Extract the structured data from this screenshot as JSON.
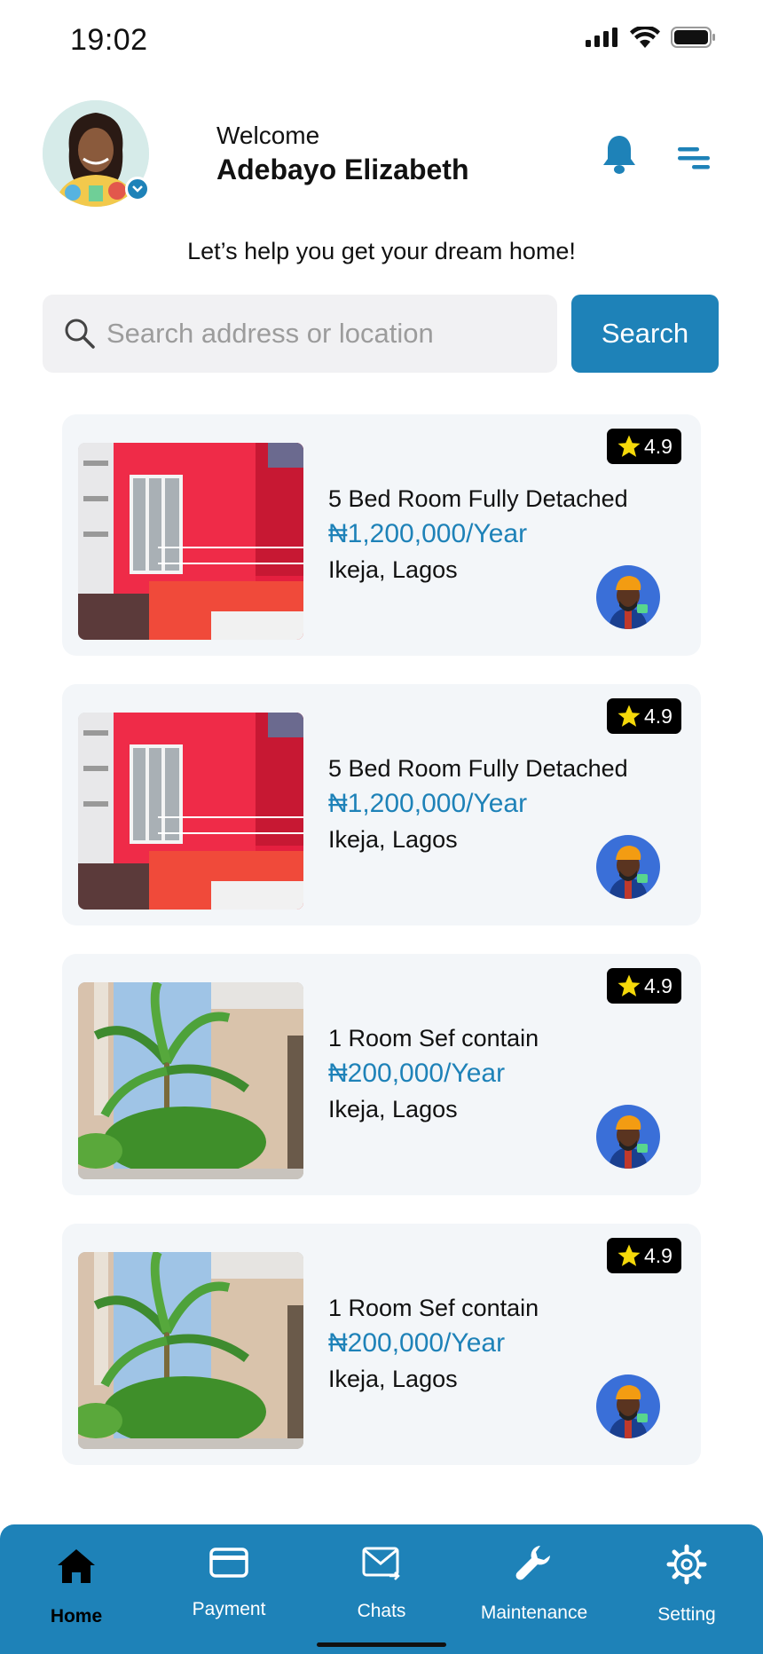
{
  "status_bar": {
    "time": "19:02"
  },
  "header": {
    "welcome": "Welcome",
    "user_name": "Adebayo Elizabeth",
    "tagline": "Let’s help you get your dream home!"
  },
  "search": {
    "placeholder": "Search address or location",
    "button_label": "Search"
  },
  "listings": [
    {
      "title": "5 Bed Room Fully Detached",
      "price": "₦1,200,000/Year",
      "location": "Ikeja, Lagos",
      "rating": "4.9",
      "image": "red-house"
    },
    {
      "title": "5 Bed Room Fully Detached",
      "price": "₦1,200,000/Year",
      "location": "Ikeja, Lagos",
      "rating": "4.9",
      "image": "red-house"
    },
    {
      "title": "1 Room Sef contain",
      "price": "₦200,000/Year",
      "location": "Ikeja, Lagos",
      "rating": "4.9",
      "image": "palm-building"
    },
    {
      "title": "1 Room Sef contain",
      "price": "₦200,000/Year",
      "location": "Ikeja, Lagos",
      "rating": "4.9",
      "image": "palm-building"
    }
  ],
  "bottom_nav": {
    "items": [
      {
        "label": "Home",
        "icon": "home-icon",
        "active": true
      },
      {
        "label": "Payment",
        "icon": "credit-card-icon",
        "active": false
      },
      {
        "label": "Chats",
        "icon": "mail-icon",
        "active": false
      },
      {
        "label": "Maintenance",
        "icon": "wrench-icon",
        "active": false
      },
      {
        "label": "Setting",
        "icon": "gear-icon",
        "active": false
      }
    ]
  },
  "colors": {
    "accent": "#1e82b8",
    "card_bg": "#f3f6f9",
    "rating_star": "#f5d90a"
  }
}
